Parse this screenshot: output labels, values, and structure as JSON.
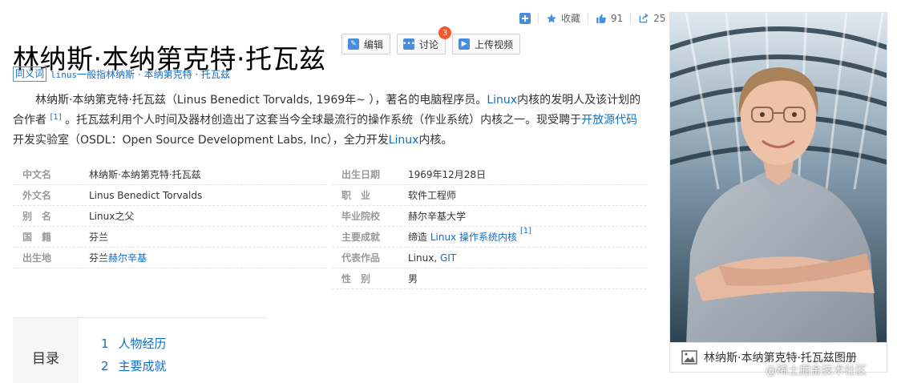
{
  "top_tools": {
    "add_icon": "plus-square-icon",
    "favorite_label": "收藏",
    "like_count": "91",
    "share_count": "25"
  },
  "title": "林纳斯·本纳第克特·托瓦兹",
  "buttons": {
    "edit_label": "编辑",
    "discuss_label": "讨论",
    "discuss_badge": "3",
    "upload_label": "上传视频"
  },
  "synonym": {
    "tag": "同义词",
    "prefix": "linus",
    "text": "一般指林纳斯 · 本纳第克特 · 托瓦兹"
  },
  "summary": {
    "p1": "林纳斯·本纳第克特·托瓦兹（Linus Benedict Torvalds, 1969年~ ），著名的电脑程序员。",
    "link_linux_1": "Linux",
    "p2": "内核的发明人及该计划的合作者",
    "ref1": "[1]",
    "p3": " 。托瓦兹利用个人时间及器材创造出了这套当今全球最流行的操作系统（作业系统）内核之一。现受聘于",
    "link_opensource": "开放源代码",
    "p4": "开发实验室（OSDL：Open Source Development Labs, Inc），全力开发",
    "link_linux_2": "Linux",
    "p5": "内核。"
  },
  "info_left": [
    {
      "key": "中文名",
      "value": "林纳斯·本纳第克特·托瓦兹"
    },
    {
      "key": "外文名",
      "value": "Linus Benedict Torvalds"
    },
    {
      "key": "别　名",
      "value": "Linux之父"
    },
    {
      "key": "国　籍",
      "value": "芬兰"
    },
    {
      "key": "出生地",
      "value_plain": "芬兰",
      "value_link": "赫尔辛基"
    }
  ],
  "info_right": [
    {
      "key": "出生日期",
      "value": "1969年12月28日"
    },
    {
      "key": "职　业",
      "value": "软件工程师"
    },
    {
      "key": "毕业院校",
      "value": "赫尔辛基大学"
    },
    {
      "key": "主要成就",
      "value_plain": "缔造 ",
      "value_link": "Linux 操作系统内核",
      "ref": "[1]"
    },
    {
      "key": "代表作品",
      "value_plain": "Linux, ",
      "value_link": "GIT"
    },
    {
      "key": "性　别",
      "value": "男"
    }
  ],
  "toc": {
    "label": "目录",
    "items": [
      {
        "num": "1",
        "text": "人物经历"
      },
      {
        "num": "2",
        "text": "主要成就"
      }
    ]
  },
  "photo": {
    "caption": "林纳斯·本纳第克特·托瓦兹图册"
  },
  "watermark": "@稀土掘金技术社区",
  "colors": {
    "link": "#136ec2",
    "badge": "#f0582d",
    "label_gray": "#999999"
  }
}
